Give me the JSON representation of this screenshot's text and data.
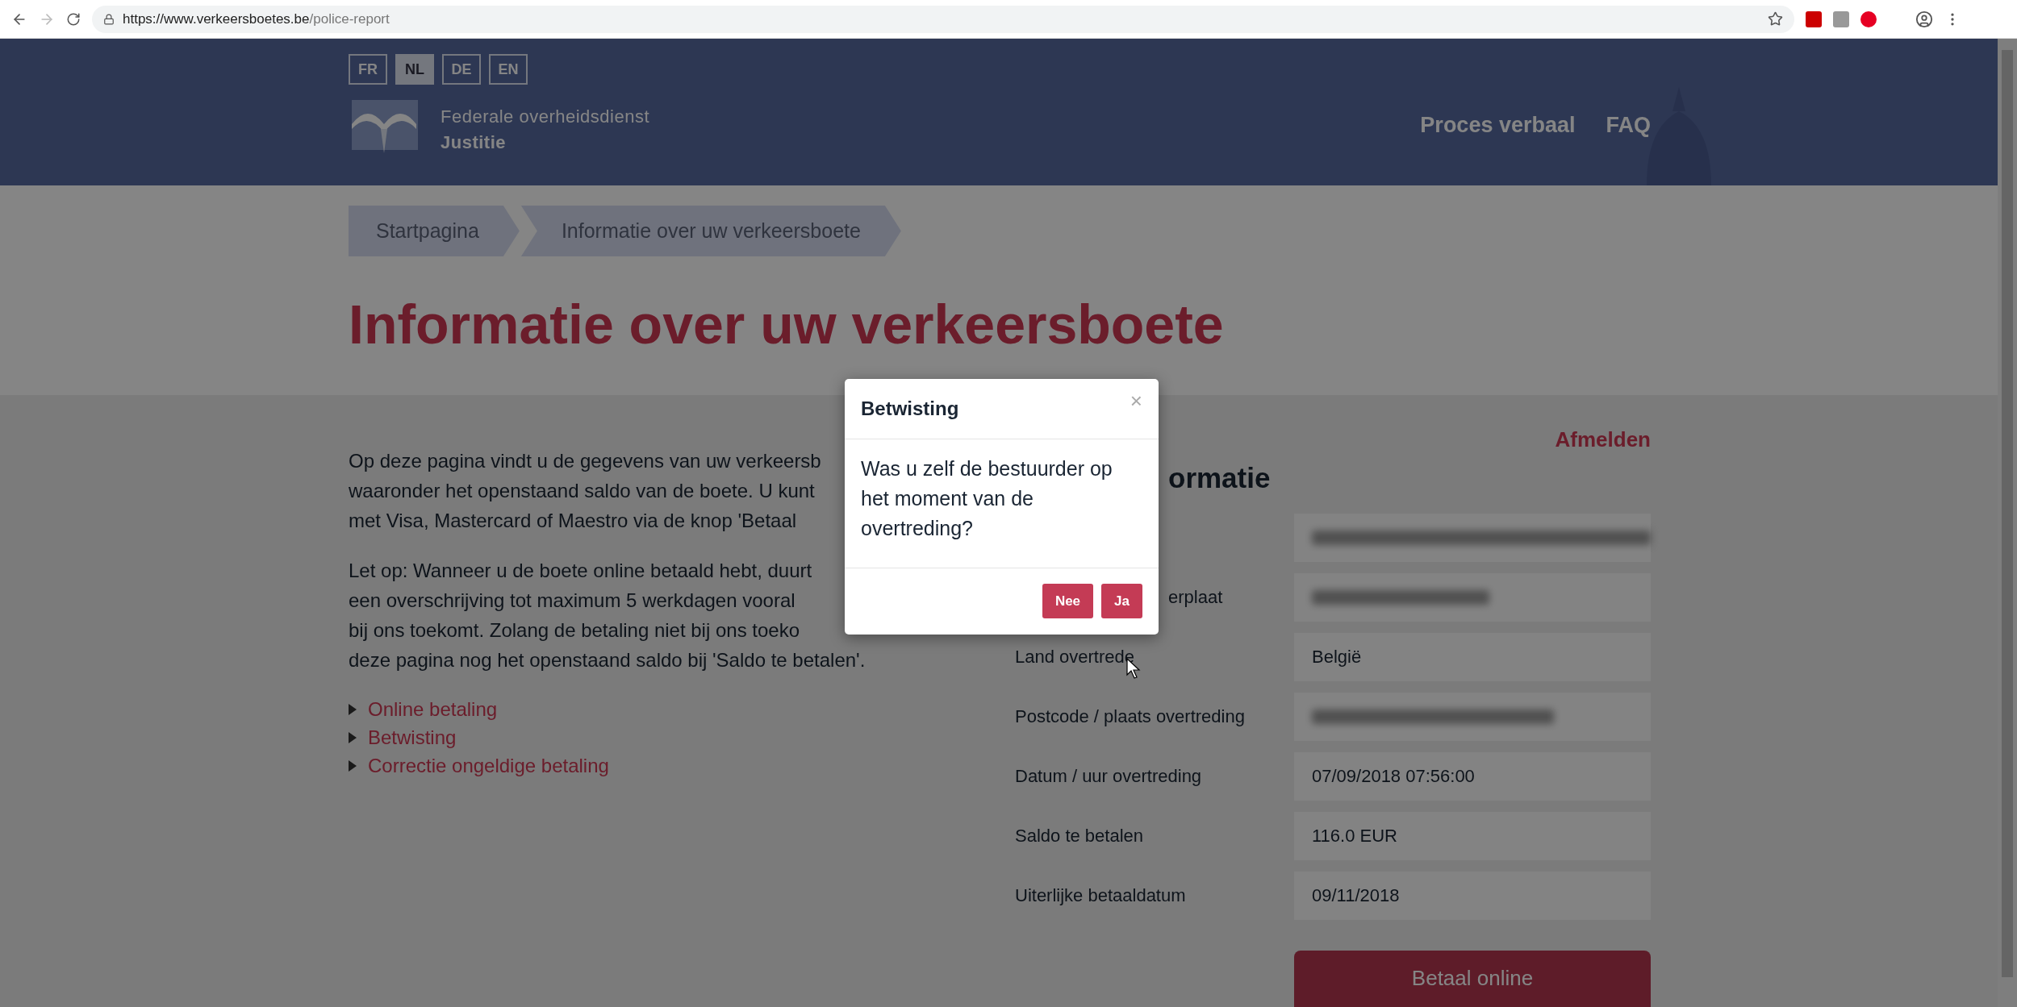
{
  "browser": {
    "url_host": "https://www.verkeersboetes.be",
    "url_path": "/police-report"
  },
  "header": {
    "languages": [
      {
        "label": "FR",
        "selected": false
      },
      {
        "label": "NL",
        "selected": true
      },
      {
        "label": "DE",
        "selected": false
      },
      {
        "label": "EN",
        "selected": false
      }
    ],
    "logo_lines": [
      "Federale overheidsdienst",
      "Justitie"
    ],
    "nav": [
      "Proces verbaal",
      "FAQ"
    ]
  },
  "breadcrumb": [
    "Startpagina",
    "Informatie over uw verkeersboete"
  ],
  "page_title": "Informatie over uw verkeersboete",
  "intro_lines": [
    [
      "Op deze pagina vindt u de gegevens van uw verkeersb",
      "waaronder het openstaand saldo van de boete. U kunt",
      "met Visa, Mastercard of Maestro via de knop 'Betaal"
    ],
    [
      "Let op: Wanneer u de boete online betaald hebt, duurt",
      "een overschrijving tot maximum 5 werkdagen vooral",
      "bij ons toekomt. Zolang de betaling niet bij ons toeko",
      "deze pagina nog het openstaand saldo bij 'Saldo te betalen'."
    ]
  ],
  "links": [
    {
      "label": "Online betaling",
      "expanded": false
    },
    {
      "label": "Betwisting",
      "expanded": false
    },
    {
      "label": "Correctie ongeldige betaling",
      "expanded": false
    }
  ],
  "logout": "Afmelden",
  "info_heading": "ormatie",
  "info_rows": [
    {
      "kind": "redacted"
    },
    {
      "label": "erplaat",
      "kind": "redacted"
    },
    {
      "label": "Land overtrede",
      "value": "België",
      "kind": "text"
    },
    {
      "label": "Postcode / plaats overtreding",
      "kind": "redacted"
    },
    {
      "label": "Datum / uur overtreding",
      "value": "07/09/2018 07:56:00",
      "kind": "text"
    },
    {
      "label": "Saldo te betalen",
      "value": "116.0 EUR",
      "kind": "text"
    },
    {
      "label": "Uiterlijke betaaldatum",
      "value": "09/11/2018",
      "kind": "text"
    }
  ],
  "pay_button": "Betaal online",
  "modal": {
    "title": "Betwisting",
    "close": "×",
    "question": "Was u zelf de bestuurder op het moment van de overtreding?",
    "buttons": [
      "Nee",
      "Ja"
    ]
  }
}
